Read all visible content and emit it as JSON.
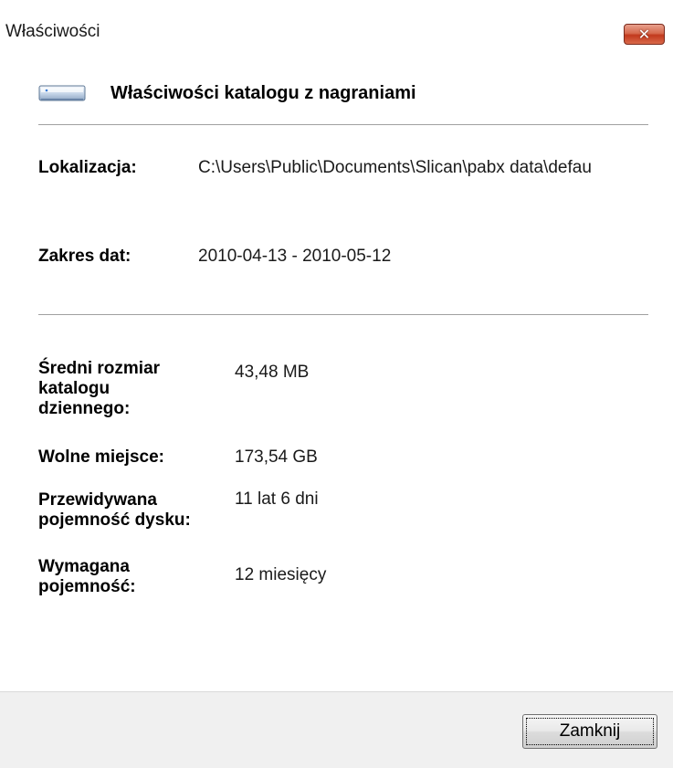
{
  "window": {
    "title": "Właściwości",
    "close_symbol": "✕"
  },
  "header": {
    "icon": "folder-drive-icon",
    "title": "Właściwości katalogu z nagraniami"
  },
  "info": {
    "location_label": "Lokalizacja:",
    "location_value": "C:\\Users\\Public\\Documents\\Slican\\pabx data\\defau",
    "date_range_label": "Zakres dat:",
    "date_range_value": "2010-04-13 - 2010-05-12"
  },
  "stats": {
    "avg_size_label_line1": "Średni rozmiar",
    "avg_size_label_line2": "katalogu",
    "avg_size_label_line3": "dziennego:",
    "avg_size_value": "43,48 MB",
    "free_space_label": "Wolne miejsce:",
    "free_space_value": "173,54 GB",
    "predicted_label_line1": "Przewidywana",
    "predicted_label_line2": "pojemność dysku:",
    "predicted_value": "11 lat 6 dni",
    "required_label_line1": "Wymagana",
    "required_label_line2": "pojemność:",
    "required_value": "12 miesięcy"
  },
  "footer": {
    "close_button": "Zamknij"
  },
  "colors": {
    "close_button_red": "#c2391d",
    "footer_bg": "#f0f0f0"
  }
}
